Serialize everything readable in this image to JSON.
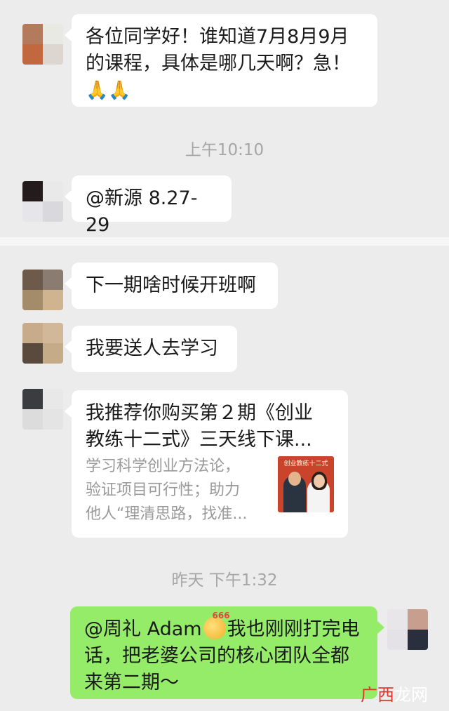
{
  "chat": {
    "msg1": {
      "line1": "各位同学好！谁知道7月8月9月",
      "line2": "的课程，具体是哪几天啊？急！",
      "emoji": "🙏🙏"
    },
    "time1": "上午10:10",
    "msg2": {
      "text": "@新源 8.27-29"
    },
    "msg3": {
      "text": "下一期啥时候开班啊"
    },
    "msg4": {
      "text": "我要送人去学习"
    },
    "card": {
      "title_line1": "我推荐你购买第２期《创业",
      "title_line2": "教练十二式》三天线下课...",
      "desc_line1": "学习科学创业方法论，",
      "desc_line2": "验证项目可行性；助力",
      "desc_line3": "他人“理清思路，找准...",
      "thumb_title": "创业教练十二式"
    },
    "time2": "昨天 下午1:32",
    "msg5": {
      "mention": "@周礼 Adam",
      "emoji_tag": "666",
      "line1_rest": "我也刚刚打完电",
      "line2": "话，把老婆公司的核心团队全都",
      "line3": "来第二期～"
    }
  },
  "watermark": {
    "part1": "广西",
    "part2": "龙网"
  },
  "colors": {
    "background": "#ececec",
    "incoming_bubble": "#ffffff",
    "outgoing_bubble": "#95ec69",
    "timestamp": "#a6a6a6",
    "watermark_accent": "#e2352c"
  },
  "icons": [
    "pray-hands-icon",
    "666-smile-emoji-icon"
  ]
}
